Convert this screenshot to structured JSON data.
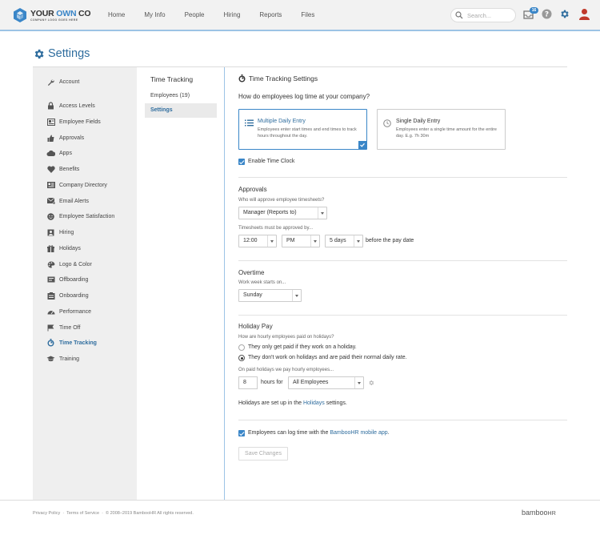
{
  "brand": {
    "logo_prefix": "YOUR ",
    "logo_accent": "OWN",
    "logo_suffix": " CO",
    "logo_tagline": "COMPANY LOGO GOES HERE",
    "accent_color": "#3a86c8"
  },
  "nav": [
    "Home",
    "My Info",
    "People",
    "Hiring",
    "Reports",
    "Files"
  ],
  "search": {
    "placeholder": "Search..."
  },
  "header": {
    "inbox_badge": "16"
  },
  "page": {
    "title": "Settings"
  },
  "sidebar": {
    "items": [
      {
        "label": "Account",
        "icon": "wrench-icon"
      },
      {
        "label": "Access Levels",
        "icon": "lock-icon"
      },
      {
        "label": "Employee Fields",
        "icon": "fields-icon"
      },
      {
        "label": "Approvals",
        "icon": "thumbs-up-icon"
      },
      {
        "label": "Apps",
        "icon": "cloud-icon"
      },
      {
        "label": "Benefits",
        "icon": "heart-icon"
      },
      {
        "label": "Company Directory",
        "icon": "directory-icon"
      },
      {
        "label": "Email Alerts",
        "icon": "email-icon"
      },
      {
        "label": "Employee Satisfaction",
        "icon": "smiley-icon"
      },
      {
        "label": "Hiring",
        "icon": "hiring-icon"
      },
      {
        "label": "Holidays",
        "icon": "gift-icon"
      },
      {
        "label": "Logo & Color",
        "icon": "palette-icon"
      },
      {
        "label": "Offboarding",
        "icon": "offboarding-icon"
      },
      {
        "label": "Onboarding",
        "icon": "onboarding-icon"
      },
      {
        "label": "Performance",
        "icon": "gauge-icon"
      },
      {
        "label": "Time Off",
        "icon": "time-off-icon"
      },
      {
        "label": "Time Tracking",
        "icon": "stopwatch-icon"
      },
      {
        "label": "Training",
        "icon": "graduation-cap-icon"
      }
    ],
    "active": "Time Tracking"
  },
  "subnav": {
    "title": "Time Tracking",
    "items": [
      "Employees (19)",
      "Settings"
    ],
    "active": "Settings"
  },
  "main": {
    "title": "Time Tracking Settings",
    "question": "How do employees log time at your company?",
    "options": [
      {
        "title": "Multiple Daily Entry",
        "desc": "Employees enter start times and end times to track hours throughout the day.",
        "selected": true
      },
      {
        "title": "Single Daily Entry",
        "desc": "Employees enter a single time amount for the entire day. E.g. 7h 30m",
        "selected": false
      }
    ],
    "enable_time_clock": "Enable Time Clock",
    "approvals": {
      "title": "Approvals",
      "who_hint": "Who will approve employee timesheets?",
      "approver": "Manager (Reports to)",
      "must_hint": "Timesheets must be approved by...",
      "time": "12:00",
      "ampm": "PM",
      "days": "5 days",
      "before": "before the pay date"
    },
    "overtime": {
      "title": "Overtime",
      "hint": "Work week starts on...",
      "day": "Sunday"
    },
    "holiday_pay": {
      "title": "Holiday Pay",
      "hint": "How are hourly employees paid on holidays?",
      "radio1": "They only get paid if they work on a holiday.",
      "radio2": "They don't work on holidays and are paid their normal daily rate.",
      "hours_hint": "On paid holidays we pay hourly employees...",
      "hours": "8",
      "hours_for": "hours for",
      "group": "All Employees",
      "setup_pre": "Holidays are set up in the ",
      "setup_link": "Holidays",
      "setup_post": " settings."
    },
    "mobile": {
      "pre": "Employees can log time with the ",
      "link": "BambooHR mobile app",
      "post": "."
    },
    "save": "Save Changes"
  },
  "footer": {
    "privacy": "Privacy Policy",
    "terms": "Terms of Service",
    "copyright": "© 2008–2019 BambooHR All rights reserved.",
    "brand_a": "bamboo",
    "brand_b": "HR"
  }
}
